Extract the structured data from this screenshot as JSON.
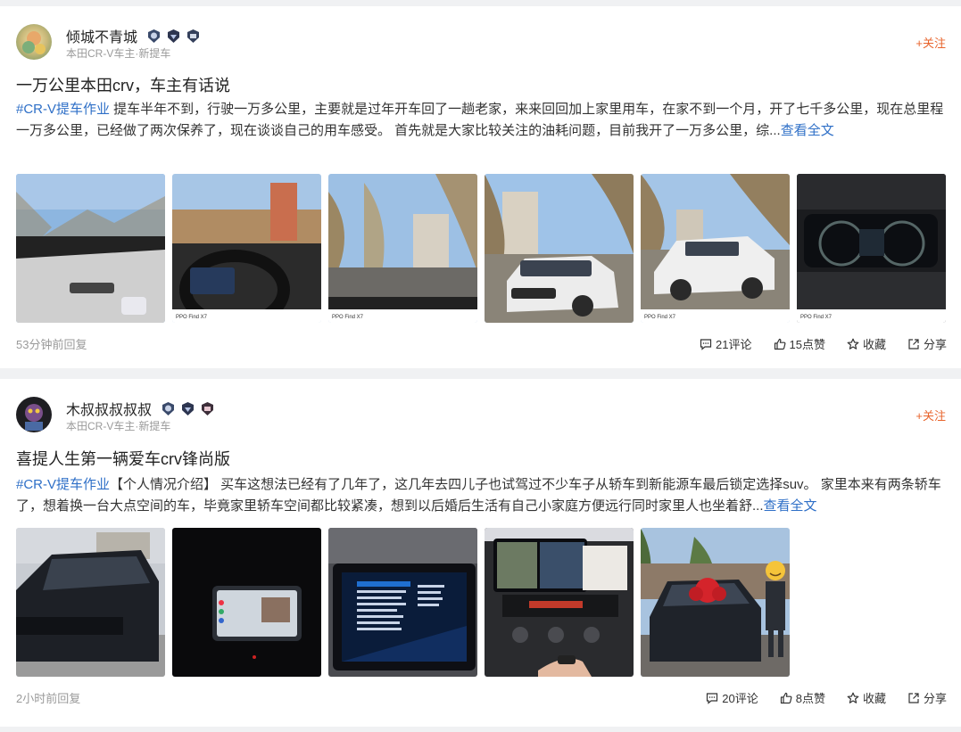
{
  "posts": [
    {
      "username": "倾城不青城",
      "subtitle": "本田CR-V车主·新提车",
      "follow_label": "+关注",
      "title": "一万公里本田crv，车主有话说",
      "tag": "#CR-V提车作业",
      "body": " 提车半年不到，行驶一万多公里，主要就是过年开车回了一趟老家，来来回回加上家里用车，在家不到一个月，开了七千多公里，现在总里程一万多公里，已经做了两次保养了，现在谈谈自己的用车感受。   首先就是大家比较关注的油耗问题，目前我开了一万多公里，综...",
      "more": "查看全文",
      "time": "53分钟前回复",
      "comments": "21评论",
      "likes": "15点赞",
      "collect": "收藏",
      "share": "分享",
      "watermark": "PPO Find X7"
    },
    {
      "username": "木叔叔叔叔叔",
      "subtitle": "本田CR-V车主·新提车",
      "follow_label": "+关注",
      "title": "喜提人生第一辆爱车crv锋尚版",
      "tag": "#CR-V提车作业",
      "body": "【个人情况介绍】 买车这想法已经有了几年了，这几年去四儿子也试驾过不少车子从轿车到新能源车最后锁定选择suv。 家里本来有两条轿车了，想着换一台大点空间的车，毕竟家里轿车空间都比较紧凑，想到以后婚后生活有自己小家庭方便远行同时家里人也坐着舒...",
      "more": "查看全文",
      "time": "2小时前回复",
      "comments": "20评论",
      "likes": "8点赞",
      "collect": "收藏",
      "share": "分享"
    }
  ],
  "colors": {
    "accent_orange": "#e8642c",
    "link_blue": "#2e6fc7",
    "muted_gray": "#9a9a9a"
  },
  "icons": [
    "comment-icon",
    "thumbs-up-icon",
    "star-icon",
    "share-icon"
  ]
}
